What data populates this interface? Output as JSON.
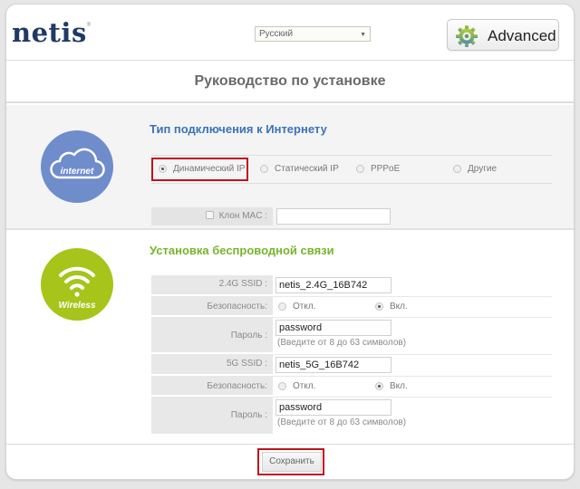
{
  "header": {
    "logo": "netis",
    "logo_mark": "®",
    "language": "Русский",
    "advanced_label": "Advanced"
  },
  "page_title": "Руководство по установке",
  "internet": {
    "icon_label": "internet",
    "title": "Тип подключения к Интернету",
    "options": [
      {
        "label": "Динамический IP",
        "selected": true
      },
      {
        "label": "Статический IP",
        "selected": false
      },
      {
        "label": "PPPoE",
        "selected": false
      },
      {
        "label": "Другие",
        "selected": false
      }
    ],
    "mac_clone_label": "Клон MAC :",
    "mac_clone_checked": false,
    "mac_clone_value": ""
  },
  "wireless": {
    "icon_label": "Wireless",
    "title": "Установка беспроводной связи",
    "band_24": {
      "ssid_label": "2.4G SSID :",
      "ssid_value": "netis_2.4G_16B742",
      "security_label": "Безопасность:",
      "security_off": "Откл.",
      "security_on": "Вкл.",
      "security_selected": "on",
      "password_label": "Пароль :",
      "password_value": "password",
      "password_hint": "(Введите от 8 до 63 символов)"
    },
    "band_5": {
      "ssid_label": "5G SSID :",
      "ssid_value": "netis_5G_16B742",
      "security_label": "Безопасность:",
      "security_off": "Откл.",
      "security_on": "Вкл.",
      "security_selected": "on",
      "password_label": "Пароль :",
      "password_value": "password",
      "password_hint": "(Введите от 8 до 63 символов)"
    }
  },
  "footer": {
    "save_label": "Сохранить"
  },
  "colors": {
    "brand_navy": "#1f3a64",
    "internet_blue": "#3a73b6",
    "internet_icon": "#6f8ccb",
    "wireless_green": "#76b52b",
    "wireless_icon": "#a6c41a",
    "highlight_red": "#c0131e"
  }
}
